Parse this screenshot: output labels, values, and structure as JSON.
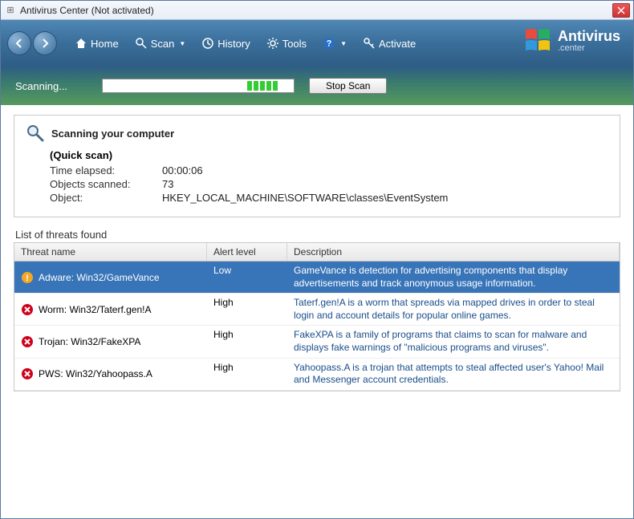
{
  "titlebar": {
    "text": "Antivirus Center (Not activated)"
  },
  "toolbar": {
    "home": "Home",
    "scan": "Scan",
    "history": "History",
    "tools": "Tools",
    "activate": "Activate"
  },
  "brand": {
    "name": "Antivirus",
    "sub": ".center"
  },
  "scanbar": {
    "label": "Scanning...",
    "stop": "Stop Scan"
  },
  "panel": {
    "title": "Scanning your computer",
    "subtitle": "(Quick scan)",
    "rows": {
      "time_label": "Time elapsed:",
      "time_val": "00:00:06",
      "objects_label": "Objects scanned:",
      "objects_val": "73",
      "object_label": "Object:",
      "object_val": "HKEY_LOCAL_MACHINE\\SOFTWARE\\classes\\EventSystem"
    }
  },
  "threats": {
    "list_title": "List of threats found",
    "headers": {
      "name": "Threat name",
      "level": "Alert level",
      "desc": "Description"
    },
    "rows": [
      {
        "icon": "warn",
        "name": "Adware: Win32/GameVance",
        "level": "Low",
        "desc": "GameVance is detection for advertising components that display advertisements and track anonymous usage information.",
        "selected": true
      },
      {
        "icon": "err",
        "name": "Worm: Win32/Taterf.gen!A",
        "level": "High",
        "desc": "Taterf.gen!A is a worm that spreads via mapped drives in order to steal login and account details for popular online games."
      },
      {
        "icon": "err",
        "name": "Trojan: Win32/FakeXPA",
        "level": "High",
        "desc": "FakeXPA is a family of programs that claims to scan for malware and displays fake warnings of \"malicious programs and viruses\"."
      },
      {
        "icon": "err",
        "name": "PWS: Win32/Yahoopass.A",
        "level": "High",
        "desc": "Yahoopass.A is a trojan that attempts to steal affected user's Yahoo! Mail and Messenger account credentials."
      }
    ]
  }
}
